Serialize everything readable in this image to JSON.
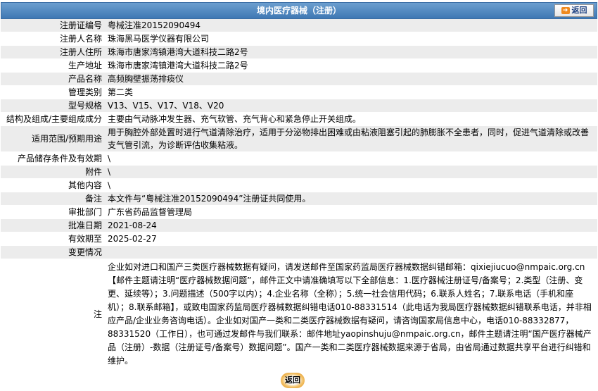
{
  "header": {
    "title": "境内医疗器械（注册）",
    "back_label": "返回"
  },
  "rows": [
    {
      "label": "注册证编号",
      "value": "粤械注准20152090494"
    },
    {
      "label": "注册人名称",
      "value": "珠海黑马医学仪器有限公司"
    },
    {
      "label": "注册人住所",
      "value": "珠海市唐家湾镇港湾大道科技二路2号"
    },
    {
      "label": "生产地址",
      "value": "珠海市唐家湾镇港湾大道科技二路2号"
    },
    {
      "label": "产品名称",
      "value": "高频胸壁振荡排痰仪"
    },
    {
      "label": "管理类别",
      "value": "第二类"
    },
    {
      "label": "型号规格",
      "value": "V13、V15、V17、V18、V20"
    },
    {
      "label": "结构及组成/主要组成成分",
      "value": "主要由气动脉冲发生器、充气软管、充气背心和紧急停止开关组成。"
    },
    {
      "label": "适用范围/预期用途",
      "value": "用于胸腔外部处置时进行气道清除治疗，适用于分泌物排出困难或由粘液阻塞引起的肺膨胀不全患者，同时，促进气道清除或改善支气管引流，为诊断评估收集粘液。"
    },
    {
      "label": "产品储存条件及有效期",
      "value": "\\"
    },
    {
      "label": "附件",
      "value": "\\"
    },
    {
      "label": "其他内容",
      "value": "\\"
    },
    {
      "label": "备注",
      "value": "本文件与“粤械注准20152090494”注册证共同使用。"
    },
    {
      "label": "审批部门",
      "value": "广东省药品监督管理局"
    },
    {
      "label": "批准日期",
      "value": "2021-08-24"
    },
    {
      "label": "有效期至",
      "value": "2025-02-27"
    },
    {
      "label": "变更情况",
      "value": ""
    }
  ],
  "note": {
    "label": "注",
    "text": "企业如对进口和国产三类医疗器械数据有疑问，请发送邮件至国家药监局医疗器械数据纠错邮箱：qixiejiucuo@nmpaic.org.cn【邮件主题请注明“医疗器械数据问题”，邮件正文中请准确填写以下全部信息：1.医疗器械注册证号/备案号；2.类型（注册、变更、延续等）；3.问题描述（500字以内）；4.企业名称（全称）；5.统一社会信用代码；6.联系人姓名；7.联系电话（手机和座机）；8.联系邮箱】，或致电国家药监局医疗器械数据纠错电话010-88331514（此电话为我局医疗器械数据纠错联系电话，并非相应产品/企业业务咨询电话）。企业如对国产一类和二类医疗器械数据有疑问，请咨询国家局信息中心，电话010-88332877，88331520（工作日），也可通过发邮件与我们联系：邮件地址yaopinshuju@nmpaic.org.cn，邮件主题请注明“国产医疗器械产品（注册）-数据（注册证号/备案号）数据问题”。国产一类和二类医疗器械数据来源于省局，由省局通过数据共享平台进行纠错和维护。"
  },
  "colors": {
    "header_bg": "#4a82bd",
    "row_alt": "#ececec",
    "back_orange": "#f08a1e"
  }
}
